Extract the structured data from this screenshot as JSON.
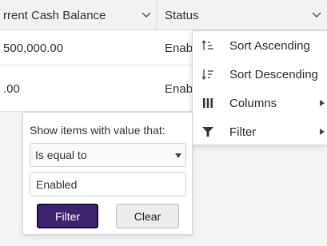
{
  "grid": {
    "headers": {
      "cash": "rrent Cash Balance",
      "status": "Status"
    },
    "rows": [
      {
        "cash": "500,000.00",
        "status": "Enab"
      },
      {
        "cash": ".00",
        "status": "Enab"
      }
    ]
  },
  "column_menu": {
    "items": [
      {
        "label": "Sort Ascending",
        "icon": "sort-ascending-icon"
      },
      {
        "label": "Sort Descending",
        "icon": "sort-descending-icon"
      },
      {
        "label": "Columns",
        "icon": "columns-icon",
        "has_submenu": true
      },
      {
        "label": "Filter",
        "icon": "filter-icon",
        "has_submenu": true
      }
    ]
  },
  "filter_panel": {
    "prompt": "Show items with value that:",
    "operator": "Is equal to",
    "value": "Enabled",
    "filter_button": "Filter",
    "clear_button": "Clear"
  },
  "colors": {
    "filter_button_bg": "#3e236f",
    "header_bg": "#f1f2f4",
    "page_bg": "#f3f4f6"
  }
}
